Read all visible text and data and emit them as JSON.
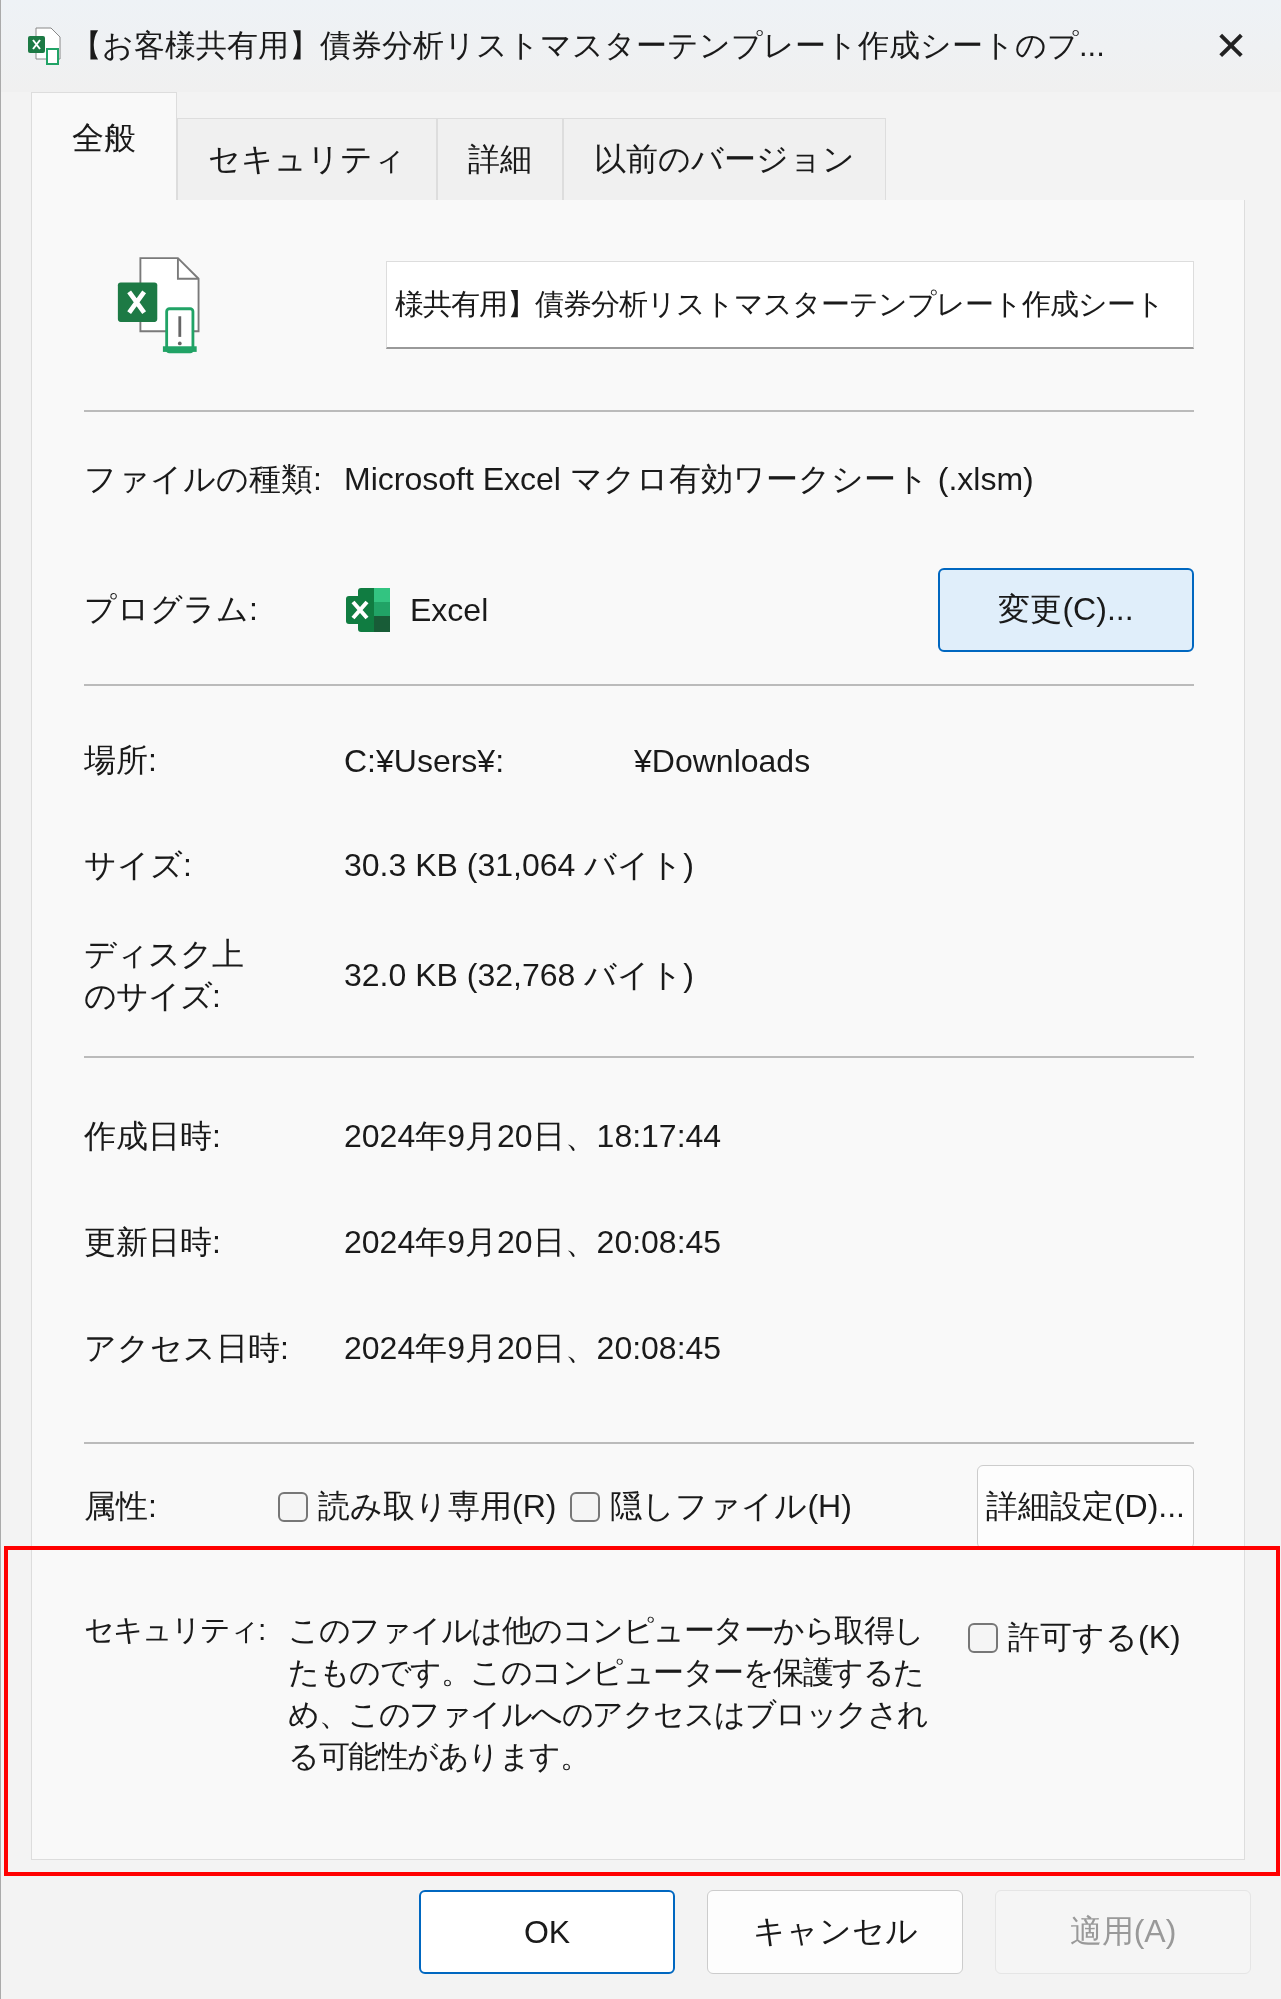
{
  "window": {
    "title": "【お客様共有用】債券分析リストマスターテンプレート作成シートのプ...",
    "close": "✕"
  },
  "tabs": [
    {
      "label": "全般",
      "selected": true
    },
    {
      "label": "セキュリティ",
      "selected": false
    },
    {
      "label": "詳細",
      "selected": false
    },
    {
      "label": "以前のバージョン",
      "selected": false
    }
  ],
  "file_name": {
    "value": "様共有用】債券分析リストマスターテンプレート作成シート"
  },
  "file_type": {
    "label": "ファイルの種類:",
    "value": "Microsoft Excel マクロ有効ワークシート (.xlsm)"
  },
  "program": {
    "label": "プログラム:",
    "value": "Excel",
    "button": {
      "label": "変更(C)...",
      "focused": true
    }
  },
  "location": {
    "label": "場所:",
    "value_parts": [
      "C:¥Users¥:",
      "¥Downloads"
    ]
  },
  "size": {
    "label": "サイズ:",
    "value": "30.3 KB (31,064 バイト)"
  },
  "size_on_disk": {
    "label": "ディスク上のサイズ:",
    "value": "32.0 KB (32,768 バイト)"
  },
  "dates": [
    {
      "label": "作成日時:",
      "value": "2024年9月20日、18:17:44"
    },
    {
      "label": "更新日時:",
      "value": "2024年9月20日、20:08:45"
    },
    {
      "label": "アクセス日時:",
      "value": "2024年9月20日、20:08:45"
    }
  ],
  "attributes": {
    "label": "属性:",
    "checkboxes": [
      {
        "label": "読み取り専用(R)",
        "checked": false
      },
      {
        "label": "隠しファイル(H)",
        "checked": false
      }
    ],
    "button": "詳細設定(D)..."
  },
  "security": {
    "label": "セキュリティ:",
    "message": "このファイルは他のコンピューターから取得したものです。このコンピューターを保護するため、このファイルへのアクセスはブロックされる可能性があります。",
    "checkbox": {
      "label": "許可する(K)",
      "checked": false
    }
  },
  "buttons": [
    {
      "label": "OK",
      "kind": "default",
      "disabled": false
    },
    {
      "label": "キャンセル",
      "kind": "normal",
      "disabled": false
    },
    {
      "label": "適用(A)",
      "kind": "normal",
      "disabled": true
    }
  ]
}
